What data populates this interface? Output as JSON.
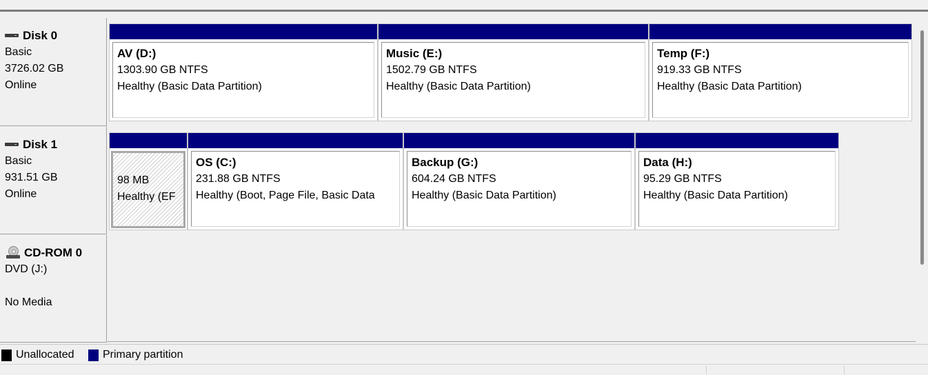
{
  "disks": [
    {
      "name": "Disk 0",
      "type": "Basic",
      "size": "3726.02 GB",
      "status": "Online"
    },
    {
      "name": "Disk 1",
      "type": "Basic",
      "size": "931.51 GB",
      "status": "Online"
    },
    {
      "name": "CD-ROM 0",
      "type": "DVD (J:)",
      "size": "",
      "status": "No Media"
    }
  ],
  "disk0_partitions": [
    {
      "title": "AV  (D:)",
      "size": "1303.90 GB NTFS",
      "health": "Healthy (Basic Data Partition)"
    },
    {
      "title": "Music  (E:)",
      "size": "1502.79 GB NTFS",
      "health": "Healthy (Basic Data Partition)"
    },
    {
      "title": "Temp  (F:)",
      "size": "919.33 GB NTFS",
      "health": "Healthy (Basic Data Partition)"
    }
  ],
  "disk1_partitions": [
    {
      "title": "",
      "size": "98 MB",
      "health": "Healthy (EF"
    },
    {
      "title": "OS  (C:)",
      "size": "231.88 GB NTFS",
      "health": "Healthy (Boot, Page File, Basic Data"
    },
    {
      "title": "Backup  (G:)",
      "size": "604.24 GB NTFS",
      "health": "Healthy (Basic Data Partition)"
    },
    {
      "title": "Data  (H:)",
      "size": "95.29 GB NTFS",
      "health": "Healthy (Basic Data Partition)"
    }
  ],
  "legend": [
    {
      "label": "Unallocated",
      "color": "#000000"
    },
    {
      "label": "Primary partition",
      "color": "#00007f"
    }
  ],
  "colors": {
    "primary_bar": "#00007f",
    "unallocated": "#000000",
    "background": "#f0f0f0"
  },
  "icons": {
    "hdd": "hard-disk-icon",
    "cdrom": "cd-rom-icon"
  }
}
